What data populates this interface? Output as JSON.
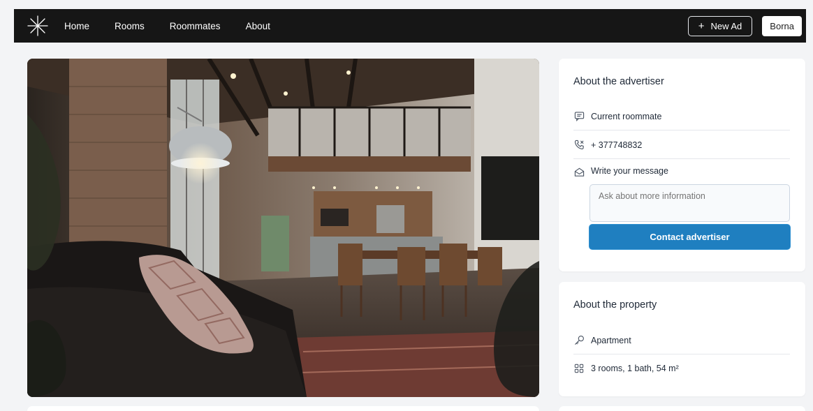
{
  "nav": {
    "logo_icon": "asterisk-logo-icon",
    "links": [
      "Home",
      "Rooms",
      "Roommates",
      "About"
    ],
    "new_ad_label": "New Ad",
    "new_ad_icon": "plus-icon",
    "user_name": "Borna"
  },
  "hero": {
    "image": "loft-apartment-interior-photo"
  },
  "advertiser": {
    "title": "About the advertiser",
    "role": "Current roommate",
    "role_icon": "chat-icon",
    "phone": "+ 377748832",
    "phone_icon": "phone-icon",
    "message_label": "Write your message",
    "message_icon": "envelope-icon",
    "message_placeholder": "Ask about more information",
    "contact_button": "Contact advertiser"
  },
  "property": {
    "title": "About the property",
    "type": "Apartment",
    "type_icon": "key-icon",
    "details": "3 rooms, 1 bath, 54 m²",
    "details_icon": "grid-icon"
  },
  "colors": {
    "navbar": "#161616",
    "accent": "#1f7fc0",
    "background": "#f3f4f6"
  }
}
